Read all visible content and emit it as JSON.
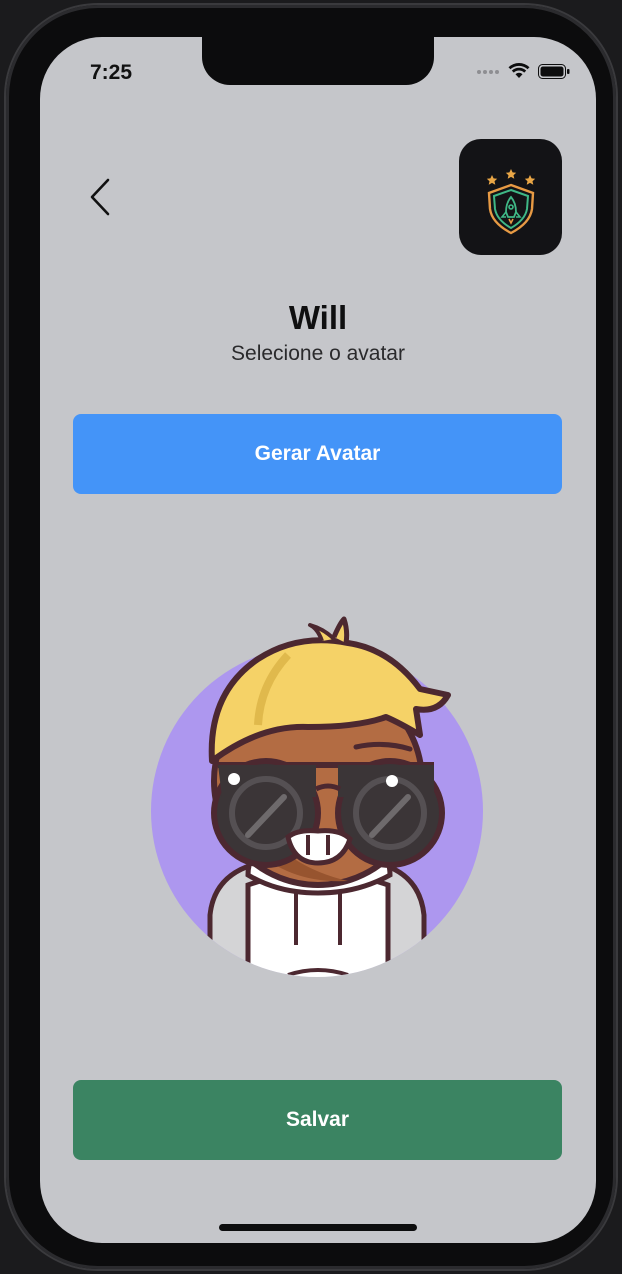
{
  "status_bar": {
    "time": "7:25",
    "icons": [
      "signal-dots-icon",
      "wifi-icon",
      "battery-icon"
    ]
  },
  "header": {
    "back_icon": "chevron-left-icon",
    "logo_icon": "shield-rocket-logo-icon"
  },
  "profile": {
    "name": "Will",
    "subtitle": "Selecione o avatar"
  },
  "actions": {
    "generate_label": "Gerar Avatar",
    "save_label": "Salvar"
  },
  "colors": {
    "background": "#c5c6ca",
    "generate_button": "#4494f8",
    "save_button": "#3b8462",
    "avatar_circle": "#ad97ef",
    "logo_bg": "#131316"
  }
}
